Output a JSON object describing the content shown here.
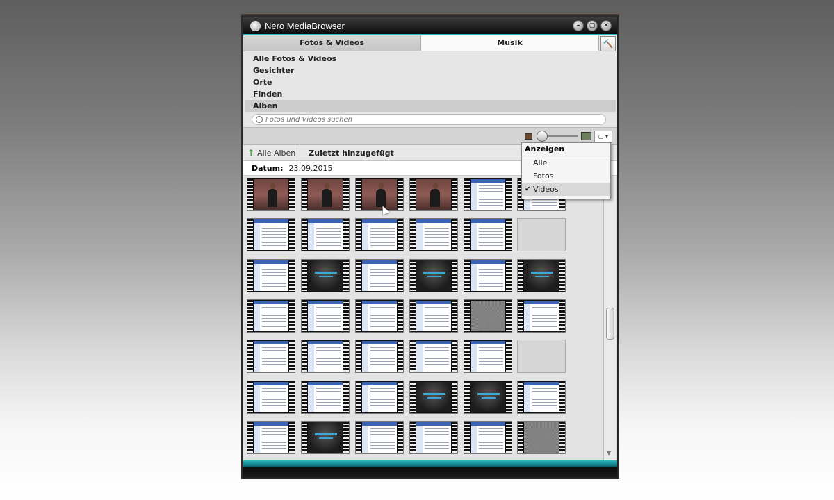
{
  "window": {
    "title": "Nero MediaBrowser",
    "buttons": [
      "–",
      "▢",
      "✕"
    ]
  },
  "tabs": [
    {
      "label": "Fotos & Videos",
      "active": true
    },
    {
      "label": "Musik",
      "active": false
    }
  ],
  "tool_icon": "hammer-icon",
  "categories": [
    {
      "label": "Alle Fotos & Videos"
    },
    {
      "label": "Gesichter"
    },
    {
      "label": "Orte"
    },
    {
      "label": "Finden"
    },
    {
      "label": "Alben",
      "selected": true
    }
  ],
  "search": {
    "placeholder": "Fotos und Videos suchen"
  },
  "nav": {
    "back_label": "Alle Alben",
    "current": "Zuletzt hinzugefügt"
  },
  "date": {
    "label": "Datum:",
    "value": "23.09.2015"
  },
  "view_menu": {
    "header": "Anzeigen",
    "items": [
      {
        "label": "Alle",
        "checked": false
      },
      {
        "label": "Fotos",
        "checked": false
      },
      {
        "label": "Videos",
        "checked": true
      }
    ]
  },
  "thumbnails": [
    [
      "speaker",
      "speaker",
      "speaker",
      "speaker",
      "doc",
      "doc"
    ],
    [
      "doc",
      "doc",
      "doc",
      "doc",
      "doc",
      "empty"
    ],
    [
      "doc",
      "dark",
      "doc",
      "dark",
      "doc",
      "dark"
    ],
    [
      "doc",
      "doc",
      "doc",
      "doc",
      "noise",
      "doc"
    ],
    [
      "doc",
      "doc",
      "doc",
      "doc",
      "doc",
      "empty"
    ],
    [
      "doc",
      "doc",
      "doc",
      "dark",
      "dark",
      "doc"
    ],
    [
      "doc",
      "dark",
      "doc",
      "doc",
      "doc",
      "noise"
    ]
  ],
  "colors": {
    "accent": "#2ab6c0",
    "titlebar": "#0c0c0c"
  }
}
